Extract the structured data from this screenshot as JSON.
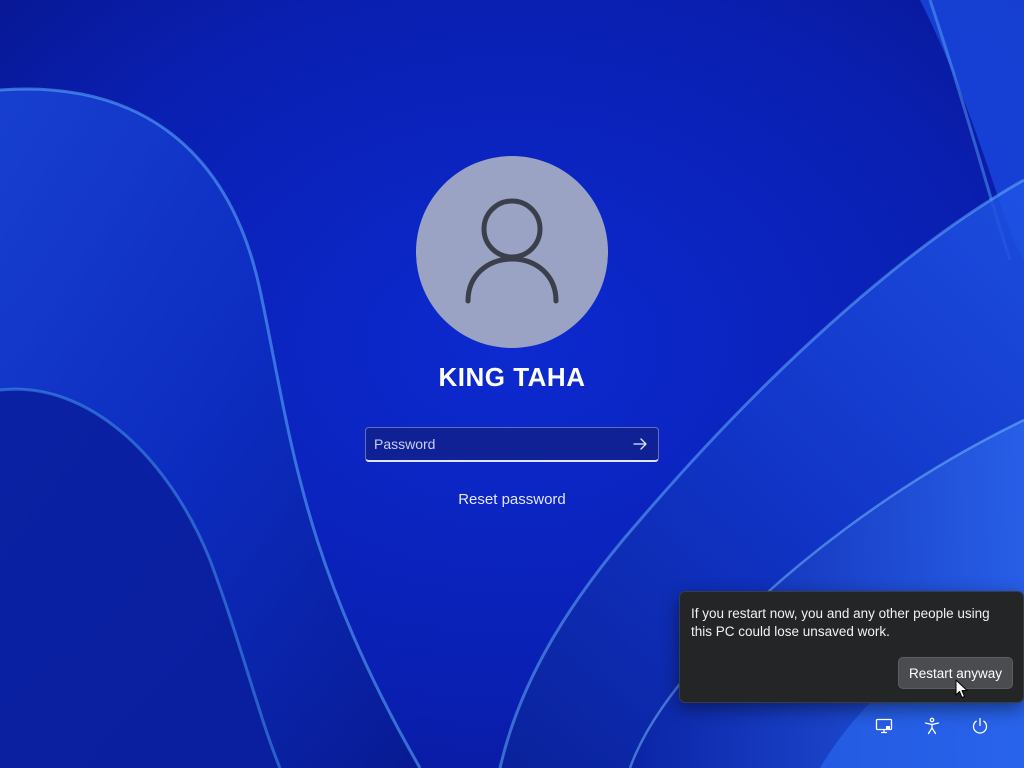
{
  "login": {
    "username": "KING TAHA",
    "password": {
      "placeholder": "Password",
      "value": ""
    },
    "reset_label": "Reset password"
  },
  "restart_flyout": {
    "message": "If you restart now, you and any other people using this PC could lose unsaved work.",
    "button_label": "Restart anyway"
  },
  "tray": {
    "icons": [
      "network-icon",
      "accessibility-icon",
      "power-icon"
    ]
  },
  "colors": {
    "wallpaper_base": "#0a1fa8",
    "avatar_bg": "#9aa3c4",
    "flyout_bg": "#232527",
    "button_bg": "#4a4c50"
  }
}
